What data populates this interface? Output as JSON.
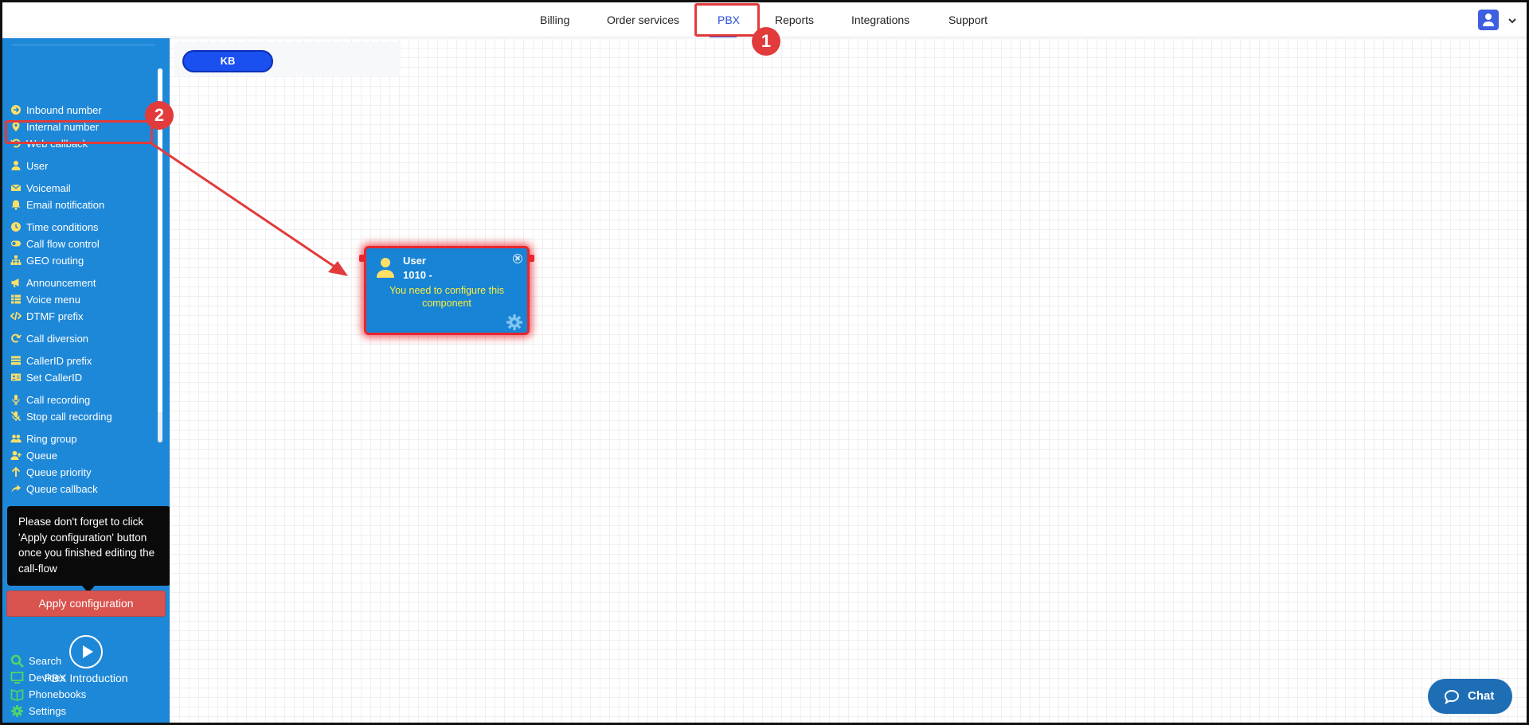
{
  "nav": {
    "items": [
      "Billing",
      "Order services",
      "PBX",
      "Reports",
      "Integrations",
      "Support"
    ],
    "active": "PBX"
  },
  "sidebar": {
    "items": [
      {
        "label": "Inbound number",
        "icon": "arrow-circle-icon"
      },
      {
        "label": "Internal number",
        "icon": "map-pin-icon"
      },
      {
        "label": "Web callback",
        "icon": "undo-icon"
      },
      {
        "label": "User",
        "icon": "user-icon"
      },
      {
        "label": "Voicemail",
        "icon": "envelope-icon"
      },
      {
        "label": "Email notification",
        "icon": "bell-icon"
      },
      {
        "label": "Time conditions",
        "icon": "clock-icon"
      },
      {
        "label": "Call flow control",
        "icon": "toggle-icon"
      },
      {
        "label": "GEO routing",
        "icon": "sitemap-icon"
      },
      {
        "label": "Announcement",
        "icon": "megaphone-icon"
      },
      {
        "label": "Voice menu",
        "icon": "grid-icon"
      },
      {
        "label": "DTMF prefix",
        "icon": "code-icon"
      },
      {
        "label": "Call diversion",
        "icon": "redo-icon"
      },
      {
        "label": "CallerID prefix",
        "icon": "list-icon"
      },
      {
        "label": "Set CallerID",
        "icon": "id-card-icon"
      },
      {
        "label": "Call recording",
        "icon": "microphone-icon"
      },
      {
        "label": "Stop call recording",
        "icon": "microphone-slash-icon"
      },
      {
        "label": "Ring group",
        "icon": "users-icon"
      },
      {
        "label": "Queue",
        "icon": "user-plus-icon"
      },
      {
        "label": "Queue priority",
        "icon": "arrow-up-icon"
      },
      {
        "label": "Queue callback",
        "icon": "share-icon"
      }
    ],
    "tooltip": "Please don't forget to click 'Apply configuration' button once you finished editing the call-flow",
    "apply_label": "Apply configuration",
    "intro_label": "PBX Introduction",
    "bottom": [
      {
        "label": "Search",
        "icon": "search-icon"
      },
      {
        "label": "Devices",
        "icon": "monitor-icon"
      },
      {
        "label": "Phonebooks",
        "icon": "book-icon"
      },
      {
        "label": "Settings",
        "icon": "gear-icon"
      }
    ]
  },
  "canvas": {
    "kb_label": "KB",
    "node": {
      "title": "User",
      "subtitle": "1010 -",
      "message": "You need to configure this component"
    }
  },
  "chat_label": "Chat",
  "annotations": {
    "badge_1": "1",
    "badge_2": "2",
    "color": "#e23b3b"
  },
  "colors": {
    "sidebar": "#1e88d8",
    "accent": "#2d4fd6",
    "icon_yellow": "#ffe066",
    "icon_green": "#4cd964",
    "apply": "#d9534f"
  }
}
